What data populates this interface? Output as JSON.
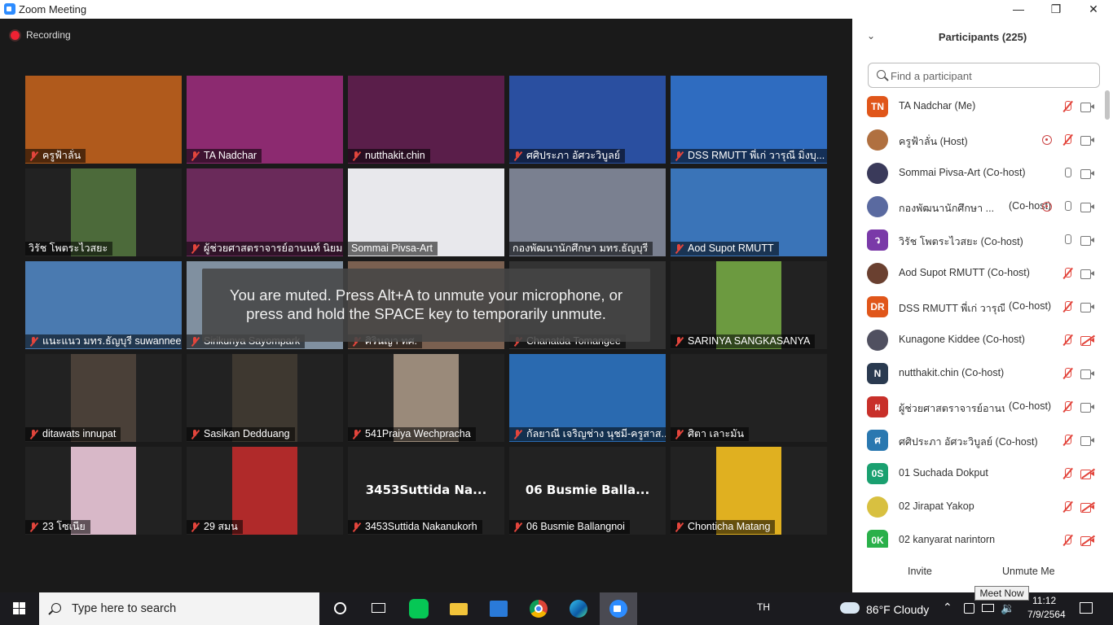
{
  "window": {
    "title": "Zoom Meeting"
  },
  "meeting": {
    "recording_label": "Recording",
    "mute_message_line1": "You are muted. Press Alt+A to unmute your microphone, or",
    "mute_message_line2": "press and hold the SPACE key to temporarily unmute.",
    "tiles": [
      {
        "name": "ครูฟ้าลั่น",
        "bg": "#b05a1c",
        "muted": true
      },
      {
        "name": "TA Nadchar",
        "bg": "#8c2a70",
        "muted": true
      },
      {
        "name": "nutthakit.chin",
        "bg": "#5a1e4a",
        "muted": true
      },
      {
        "name": "ศศิประภา อัศวะวิบูลย์",
        "bg": "#2a4fa0",
        "muted": true
      },
      {
        "name": "DSS RMUTT พี่เก่ วารุณี มิ่งบุ...",
        "bg": "#2f6cc0",
        "muted": true
      },
      {
        "name": "วิรัช  โพตระไวสยะ",
        "bg": "#4c6a3a",
        "muted": false
      },
      {
        "name": "ผู้ช่วยศาสตราจารย์อานนท์ นิยม...",
        "bg": "#6a2a5a",
        "muted": true
      },
      {
        "name": "Sommai Pivsa-Art",
        "bg": "#e8e8ec",
        "muted": false
      },
      {
        "name": "กองพัฒนานักศึกษา มทร.ธัญบุรี",
        "bg": "#7a8090",
        "muted": false,
        "active": true
      },
      {
        "name": "Aod Supot RMUTT",
        "bg": "#3a74b8",
        "muted": true
      },
      {
        "name": "แนะแนว มทร.ธัญบุรี suwannee",
        "bg": "#4a7ab0",
        "muted": true
      },
      {
        "name": "Sirikunya Sayompark",
        "bg": "#8090a0",
        "muted": true
      },
      {
        "name": "ศิรินญา ทศ.",
        "bg": "#7a6050",
        "muted": true
      },
      {
        "name": "Chanatda Tomangee",
        "bg": "#333333",
        "muted": true
      },
      {
        "name": "SARINYA SANGKASANYA",
        "bg": "#6c9a40",
        "muted": true
      },
      {
        "name": "ditawats innupat",
        "bg": "#4a4038",
        "muted": true
      },
      {
        "name": "Sasikan Dedduang",
        "bg": "#3e3830",
        "muted": true
      },
      {
        "name": "541Praiya Wechpracha",
        "bg": "#9a8a7a",
        "muted": true
      },
      {
        "name": "กัลยาณี เจริญช่าง นุชมี-ครูสาส...",
        "bg": "#2a6ab0",
        "muted": true
      },
      {
        "name": "ศิตา เลาะมัน",
        "bg": "#222222",
        "muted": true
      },
      {
        "name": "23 โซเนีย",
        "bg": "#d8b8c8",
        "muted": true
      },
      {
        "name": "29 สมน",
        "bg": "#b02a2a",
        "muted": true
      },
      {
        "name": "3453Suttida Nakanukorh",
        "bg": "#222222",
        "muted": true,
        "big_name": "3453Suttida Na..."
      },
      {
        "name": "06 Busmie Ballangnoi",
        "bg": "#222222",
        "muted": true,
        "big_name": "06 Busmie Balla..."
      },
      {
        "name": "Chonticha Matang",
        "bg": "#e0b020",
        "muted": true
      }
    ]
  },
  "participants": {
    "title": "Participants (225)",
    "search_placeholder": "Find a participant",
    "list": [
      {
        "avatar": "TN",
        "color": "#e0561a",
        "name": "TA Nadchar (Me)",
        "role": "",
        "spot": false,
        "mic": "muted",
        "cam": "on"
      },
      {
        "avatar": "",
        "color": "#b07040",
        "photo": true,
        "name": "ครูฟ้าลั่น (Host)",
        "role": "",
        "spot": true,
        "mic": "muted",
        "cam": "on"
      },
      {
        "avatar": "",
        "color": "#3a3a5a",
        "photo": true,
        "name": "Sommai Pivsa-Art (Co-host)",
        "role": "",
        "spot": false,
        "mic": "on",
        "cam": "on"
      },
      {
        "avatar": "",
        "color": "#5a6aa0",
        "photo": true,
        "name": "กองพัฒนานักศึกษา ...",
        "role": "(Co-host)",
        "spot": true,
        "mic": "on",
        "cam": "on"
      },
      {
        "avatar": "ว",
        "color": "#7a3aa8",
        "name": "วิรัช  โพตระไวสยะ (Co-host)",
        "role": "",
        "spot": false,
        "mic": "on",
        "cam": "on"
      },
      {
        "avatar": "",
        "color": "#6a4030",
        "photo": true,
        "name": "Aod Supot RMUTT (Co-host)",
        "role": "",
        "spot": false,
        "mic": "muted",
        "cam": "on"
      },
      {
        "avatar": "DR",
        "color": "#e0561a",
        "name": "DSS RMUTT พี่เก่ วารุณี...",
        "role": "(Co-host)",
        "spot": false,
        "mic": "muted",
        "cam": "on"
      },
      {
        "avatar": "",
        "color": "#505060",
        "photo": true,
        "name": "Kunagone Kiddee (Co-host)",
        "role": "",
        "spot": false,
        "mic": "muted",
        "cam": "off"
      },
      {
        "avatar": "N",
        "color": "#2a3a50",
        "name": "nutthakit.chin (Co-host)",
        "role": "",
        "spot": false,
        "mic": "muted",
        "cam": "on"
      },
      {
        "avatar": "ผ",
        "color": "#c8302a",
        "name": "ผู้ช่วยศาสตราจารย์อานน...",
        "role": "(Co-host)",
        "spot": false,
        "mic": "muted",
        "cam": "on"
      },
      {
        "avatar": "ศ",
        "color": "#2a78b0",
        "name": "ศศิประภา อัศวะวิบูลย์ (Co-host)",
        "role": "",
        "spot": false,
        "mic": "muted",
        "cam": "on"
      },
      {
        "avatar": "0S",
        "color": "#1aa070",
        "name": "01 Suchada Dokput",
        "role": "",
        "spot": false,
        "mic": "muted",
        "cam": "off"
      },
      {
        "avatar": "",
        "color": "#d8c040",
        "photo": true,
        "name": "02 Jirapat Yakop",
        "role": "",
        "spot": false,
        "mic": "muted",
        "cam": "off"
      },
      {
        "avatar": "0K",
        "color": "#2ab04a",
        "name": "02 kanyarat narintorn",
        "role": "",
        "spot": false,
        "mic": "muted",
        "cam": "off"
      }
    ],
    "invite_label": "Invite",
    "unmute_label": "Unmute Me"
  },
  "taskbar": {
    "search_placeholder": "Type here to search",
    "lang": "TH",
    "weather": "86°F  Cloudy",
    "time": "11:12",
    "date": "7/9/2564",
    "tooltip": "Meet Now"
  }
}
